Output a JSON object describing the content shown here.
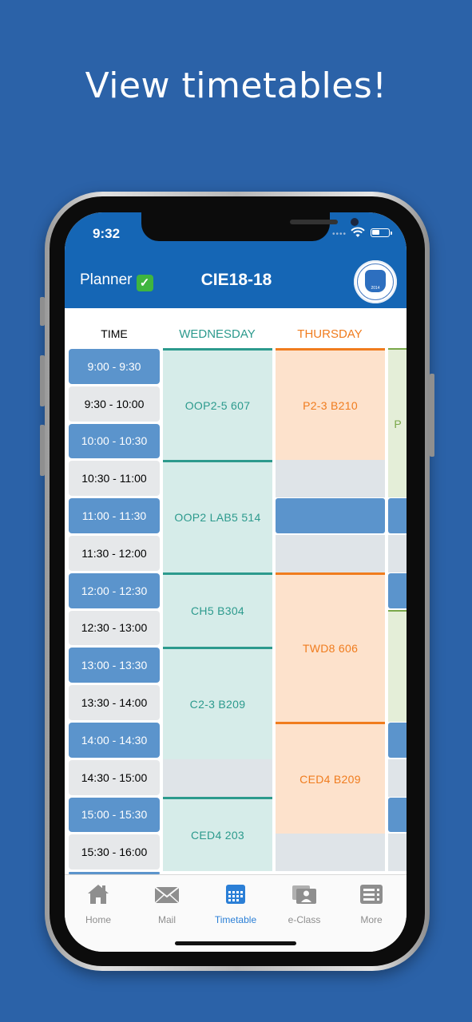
{
  "headline": "View timetables!",
  "status": {
    "time": "9:32",
    "dots": "••••"
  },
  "header": {
    "planner_label": "Planner",
    "check_glyph": "✓",
    "title": "CIE18-18",
    "logo_year": "2014"
  },
  "columns": {
    "time": "TIME",
    "wednesday": "WEDNESDAY",
    "thursday": "THURSDAY"
  },
  "time_slots": [
    "9:00 - 9:30",
    "9:30 - 10:00",
    "10:00 - 10:30",
    "10:30 - 11:00",
    "11:00 - 11:30",
    "11:30 - 12:00",
    "12:00 - 12:30",
    "12:30 - 13:00",
    "13:00 - 13:30",
    "13:30 - 14:00",
    "14:00 - 14:30",
    "14:30 - 15:00",
    "15:00 - 15:30",
    "15:30 - 16:00"
  ],
  "wednesday": [
    {
      "label": "OOP2-5 607",
      "start": 0,
      "span": 3
    },
    {
      "label": "OOP2 LAB5 514",
      "start": 3,
      "span": 3
    },
    {
      "label": "CH5 B304",
      "start": 6,
      "span": 2
    },
    {
      "label": "C2-3 B209",
      "start": 8,
      "span": 3
    },
    {
      "label": "",
      "start": 11,
      "span": 1
    },
    {
      "label": "CED4 203",
      "start": 12,
      "span": 2
    }
  ],
  "thursday": [
    {
      "label": "P2-3 B210",
      "start": 0,
      "span": 3
    },
    {
      "label": "",
      "start": 3,
      "span": 1
    },
    {
      "label": "",
      "start": 5,
      "span": 1
    },
    {
      "label": "TWD8 606",
      "start": 6,
      "span": 4
    },
    {
      "label": "CED4 B209",
      "start": 10,
      "span": 3
    },
    {
      "label": "",
      "start": 13,
      "span": 1
    }
  ],
  "friday_partial": {
    "label": "P"
  },
  "tabs": [
    {
      "label": "Home",
      "icon": "home-icon"
    },
    {
      "label": "Mail",
      "icon": "mail-icon"
    },
    {
      "label": "Timetable",
      "icon": "calendar-icon",
      "active": true
    },
    {
      "label": "e-Class",
      "icon": "eclass-icon"
    },
    {
      "label": "More",
      "icon": "more-icon"
    }
  ],
  "colors": {
    "background": "#2b62a8",
    "nav": "#1566b5",
    "wednesday": "#2c9a8d",
    "thursday": "#f07c1e",
    "slot_blue": "#5b94cc",
    "active_tab": "#2b7fd6"
  }
}
